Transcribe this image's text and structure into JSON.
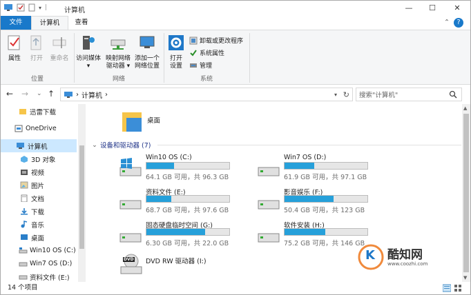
{
  "window": {
    "title": "计算机",
    "quick_access_sep": "|",
    "minimize": "—",
    "maximize": "☐",
    "close": "✕"
  },
  "ribbon_tabs": {
    "file": "文件",
    "computer": "计算机",
    "view": "查看",
    "expand": "⌃",
    "help": "?"
  },
  "ribbon": {
    "location": {
      "label": "位置",
      "properties": "属性",
      "open": "打开",
      "rename": "重命名"
    },
    "network": {
      "label": "网络",
      "access_media": "访问媒体",
      "map_drive_1": "映射网络",
      "map_drive_2": "驱动器",
      "add_location_1": "添加一个",
      "add_location_2": "网络位置"
    },
    "system": {
      "label": "系统",
      "open_settings_1": "打开",
      "open_settings_2": "设置",
      "uninstall": "卸载或更改程序",
      "sys_props": "系统属性",
      "manage": "管理"
    }
  },
  "nav": {
    "back": "←",
    "forward": "→",
    "recent": "⌄",
    "up": "↑",
    "address_path": "计算机",
    "address_sep": "›",
    "search_placeholder": "搜索\"计算机\""
  },
  "sidebar": {
    "items": [
      {
        "label": "迅雷下载"
      },
      {
        "label": "OneDrive"
      },
      {
        "label": "计算机"
      },
      {
        "label": "3D 对象"
      },
      {
        "label": "视频"
      },
      {
        "label": "图片"
      },
      {
        "label": "文档"
      },
      {
        "label": "下载"
      },
      {
        "label": "音乐"
      },
      {
        "label": "桌面"
      },
      {
        "label": "Win10 OS (C:)"
      },
      {
        "label": "Win7 OS (D:)"
      },
      {
        "label": "资料文件 (E:)"
      }
    ]
  },
  "content": {
    "desktop_folder": "桌面",
    "drives_header": "设备和驱动器 (7)",
    "drives": [
      {
        "name": "Win10 OS (C:)",
        "info": "64.1 GB 可用，共 96.3 GB",
        "used": 0.33
      },
      {
        "name": "Win7 OS (D:)",
        "info": "61.9 GB 可用，共 97.1 GB",
        "used": 0.36
      },
      {
        "name": "资料文件 (E:)",
        "info": "68.7 GB 可用，共 97.6 GB",
        "used": 0.3
      },
      {
        "name": "影音娱乐 (F:)",
        "info": "50.4 GB 可用，共 123 GB",
        "used": 0.59
      },
      {
        "name": "固态硬盘临时空间 (G:)",
        "info": "6.30 GB 可用，共 22.0 GB",
        "used": 0.71
      },
      {
        "name": "软件安装 (H:)",
        "info": "75.2 GB 可用，共 146 GB",
        "used": 0.49
      }
    ],
    "dvd": "DVD RW 驱动器 (I:)",
    "dvd_icon_text": "DVD"
  },
  "statusbar": {
    "count": "14 个项目"
  },
  "watermark": {
    "brand": "酷知网",
    "url": "www.coozhi.com",
    "logo_letter": "K"
  },
  "colors": {
    "accent": "#1979ca",
    "bar_fill": "#26a0da",
    "selected": "#cce8ff"
  }
}
